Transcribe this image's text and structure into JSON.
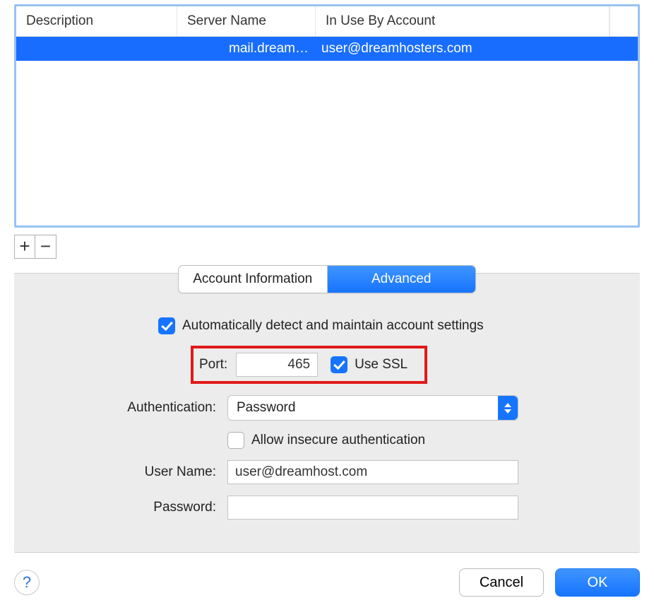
{
  "list": {
    "headers": [
      "Description",
      "Server Name",
      "In Use By Account"
    ],
    "rows": [
      {
        "description": "",
        "server": "mail.dream…",
        "in_use": "user@dreamhosters.com",
        "selected": true
      }
    ]
  },
  "addremove": {
    "plus": "+",
    "minus": "−"
  },
  "tabs": [
    {
      "label": "Account Information",
      "active": false
    },
    {
      "label": "Advanced",
      "active": true
    }
  ],
  "auto_detect": {
    "checked": true,
    "label": "Automatically detect and maintain account settings"
  },
  "port_row": {
    "label": "Port:",
    "value": "465",
    "ssl_checked": true,
    "ssl_label": "Use SSL"
  },
  "auth_row": {
    "label": "Authentication:",
    "value": "Password"
  },
  "insecure": {
    "checked": false,
    "label": "Allow insecure authentication"
  },
  "username": {
    "label": "User Name:",
    "value": "user@dreamhost.com"
  },
  "password": {
    "label": "Password:",
    "value": ""
  },
  "footer": {
    "help": "?",
    "cancel": "Cancel",
    "ok": "OK"
  }
}
